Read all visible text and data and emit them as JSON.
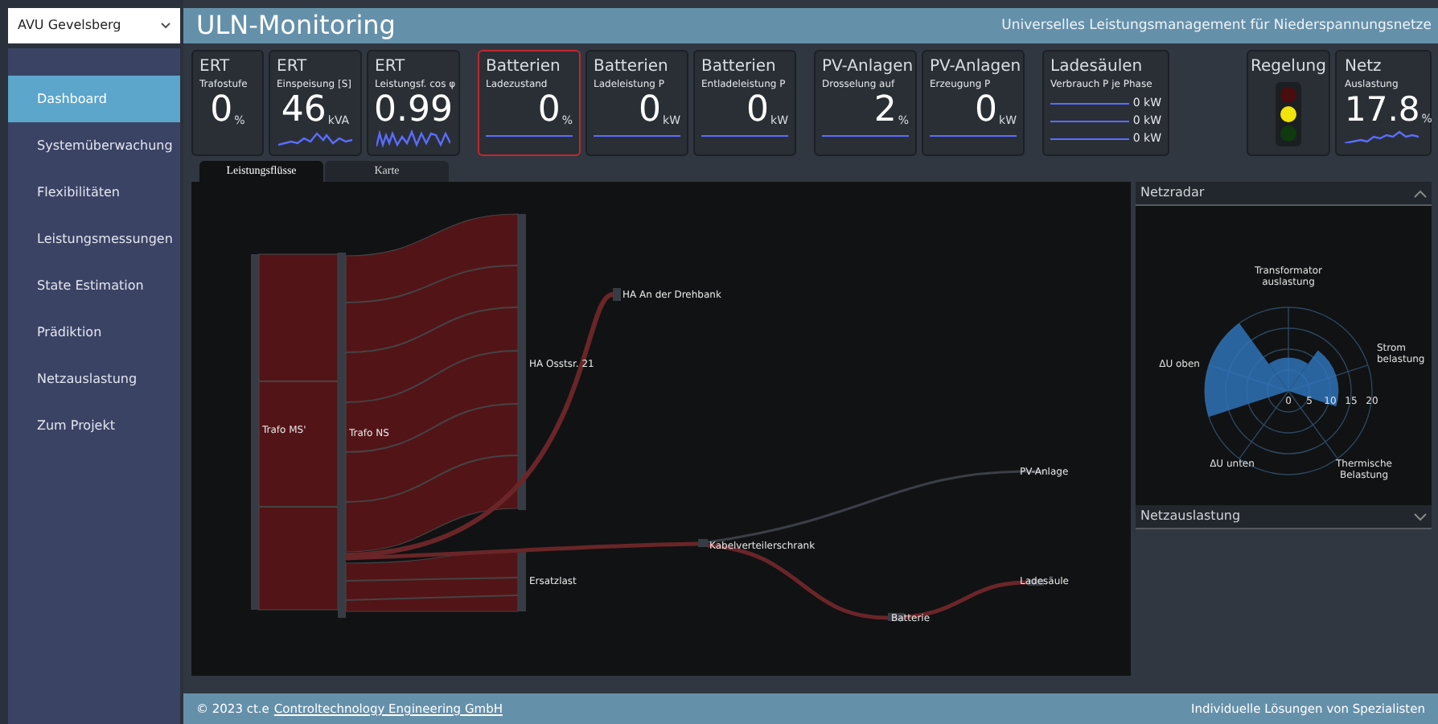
{
  "site_selector": {
    "value": "AVU Gevelsberg"
  },
  "header": {
    "title": "ULN-Monitoring",
    "subtitle": "Universelles Leistungsmanagement für Niederspannungsnetze"
  },
  "sidebar": {
    "items": [
      {
        "label": "Dashboard",
        "selected": true
      },
      {
        "label": "Systemüberwachung",
        "selected": false
      },
      {
        "label": "Flexibilitäten",
        "selected": false
      },
      {
        "label": "Leistungsmessungen",
        "selected": false
      },
      {
        "label": "State Estimation",
        "selected": false
      },
      {
        "label": "Prädiktion",
        "selected": false
      },
      {
        "label": "Netzauslastung",
        "selected": false
      },
      {
        "label": "Zum Projekt",
        "selected": false
      }
    ]
  },
  "kpi_cards": [
    {
      "kind": "plain",
      "group": "ERT",
      "title": "Trafostufe",
      "value": "0",
      "unit": "%",
      "alert": false
    },
    {
      "kind": "sparkline",
      "group": "ERT",
      "title": "Einspeisung [S]",
      "value": "46",
      "unit": "kVA",
      "alert": false
    },
    {
      "kind": "sparkline",
      "group": "ERT",
      "title": "Leistungsf. cos φ",
      "value": "0.99",
      "alert": false
    },
    {
      "kind": "line",
      "group": "Batterien",
      "title": "Ladezustand",
      "value": "0",
      "unit": "%",
      "alert": true
    },
    {
      "kind": "line",
      "group": "Batterien",
      "title": "Ladeleistung P",
      "value": "0",
      "unit": "kW",
      "alert": false
    },
    {
      "kind": "line",
      "group": "Batterien",
      "title": "Entladeleistung P",
      "value": "0",
      "unit": "kW",
      "alert": false
    },
    {
      "kind": "line",
      "group": "PV-Anlagen",
      "title": "Drosselung auf",
      "value": "2",
      "unit": "%",
      "alert": false
    },
    {
      "kind": "line",
      "group": "PV-Anlagen",
      "title": "Erzeugung P",
      "value": "0",
      "unit": "kW",
      "alert": false
    },
    {
      "kind": "phases",
      "group": "Ladesäulen",
      "title": "Verbrauch P je Phase",
      "phases": [
        "0 kW",
        "0 kW",
        "0 kW"
      ],
      "alert": false
    }
  ],
  "status_cards": [
    {
      "kind": "traffic_light",
      "group": "Regelung",
      "lamps": [
        {
          "color": "#4a0d0d"
        },
        {
          "color": "#f0e40a"
        },
        {
          "color": "#0e3a0e"
        }
      ]
    },
    {
      "kind": "sparkline",
      "group": "Netz",
      "title": "Auslastung",
      "value": "17.8",
      "unit": "%"
    }
  ],
  "tabs": [
    {
      "label": "Leistungsflüsse",
      "selected": true
    },
    {
      "label": "Karte",
      "selected": false
    }
  ],
  "sankey": {
    "nodes": [
      {
        "label": "Trafo MS'"
      },
      {
        "label": "Trafo NS"
      },
      {
        "label": "HA An der Drehbank"
      },
      {
        "label": "HA Osstsr. 21"
      },
      {
        "label": "Ersatzlast"
      },
      {
        "label": "Kabelverteilerschrank"
      },
      {
        "label": "PV-Anlage"
      },
      {
        "label": "Batterie"
      },
      {
        "label": "Ladesäule"
      }
    ]
  },
  "side_panels": [
    {
      "kind": "radar",
      "title": "Netzradar",
      "expanded": true,
      "axis_labels": [
        "Transformator auslastung",
        "ΔU oben",
        "Strom belastung",
        "ΔU unten",
        "Thermische Belastung"
      ],
      "radial_scale": [
        "0",
        "5",
        "10",
        "15",
        "20"
      ]
    },
    {
      "kind": "collapsed",
      "title": "Netzauslastung",
      "expanded": false
    }
  ],
  "footer": {
    "copyright": "© 2023 ct.e",
    "link": "Controltechnology Engineering GmbH",
    "tagline": "Individuelle Lösungen von Spezialisten"
  }
}
